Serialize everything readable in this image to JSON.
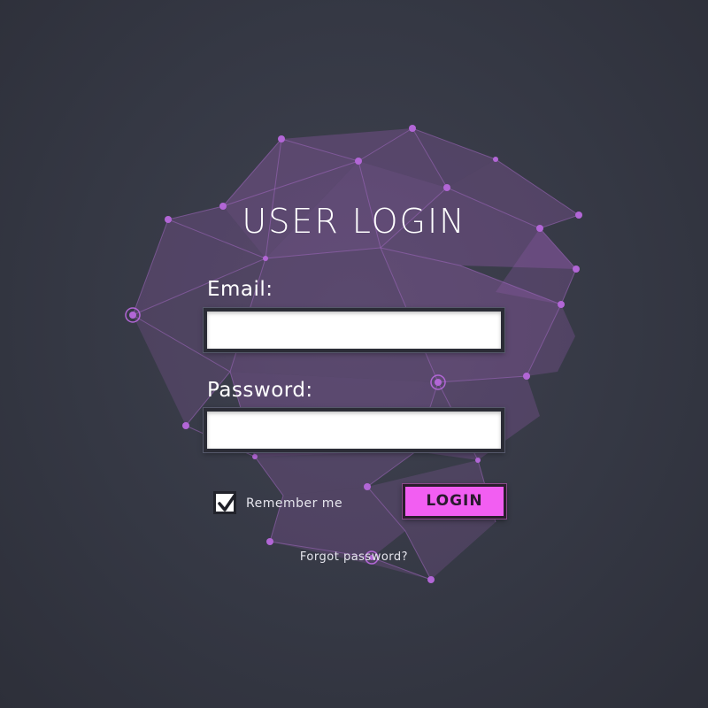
{
  "colors": {
    "background": "#353844",
    "mesh_purple": "#8e5aa8",
    "node_purple": "#b266d6",
    "button_pink": "#f25ef2"
  },
  "form": {
    "title": "USER LOGIN",
    "email_label": "Email:",
    "email_value": "",
    "password_label": "Password:",
    "password_value": "",
    "remember_label": "Remember me",
    "remember_checked": true,
    "login_label": "LOGIN",
    "forgot_label": "Forgot password?"
  },
  "icons": {
    "checkbox": "checkmark-icon"
  }
}
